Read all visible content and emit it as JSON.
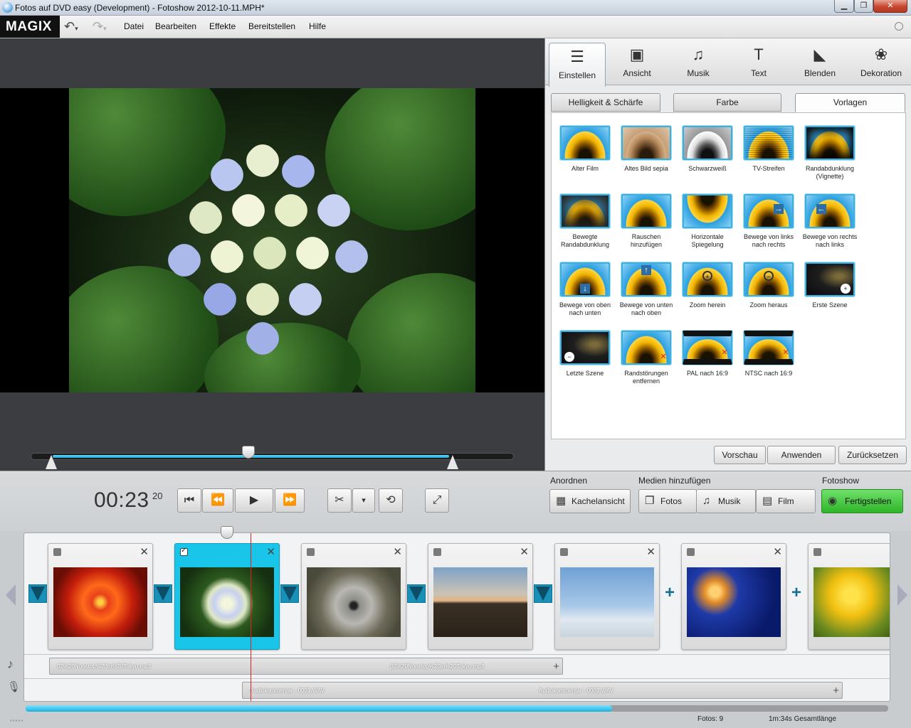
{
  "window": {
    "title": "Fotos auf DVD easy (Development) - Fotoshow 2012-10-11.MPH*",
    "minimize": "▁",
    "maximize": "❐",
    "close": "✕"
  },
  "menubar": {
    "logo": "MAGIX",
    "undo_icon": "undo-icon",
    "redo_icon": "redo-icon",
    "items": [
      "Datei",
      "Bearbeiten",
      "Effekte",
      "Bereitstellen",
      "Hilfe"
    ]
  },
  "panel": {
    "tabs": [
      {
        "label": "Einstellen",
        "icon": "sliders-icon",
        "glyph": "☰"
      },
      {
        "label": "Ansicht",
        "icon": "photo-stack-icon",
        "glyph": "▣"
      },
      {
        "label": "Musik",
        "icon": "music-note-icon",
        "glyph": "♫"
      },
      {
        "label": "Text",
        "icon": "text-t-icon",
        "glyph": "T"
      },
      {
        "label": "Blenden",
        "icon": "transition-icon",
        "glyph": "◣"
      },
      {
        "label": "Dekoration",
        "icon": "flower-icon",
        "glyph": "❀"
      }
    ],
    "subtabs": [
      "Helligkeit & Schärfe",
      "Farbe",
      "Vorlagen"
    ],
    "templates": [
      "Alter Film",
      "Altes Bild sepia",
      "Schwarzweiß",
      "TV-Streifen",
      "Randabdunklung (Vignette)",
      "Bewegte Randabdunklung",
      "Rauschen hinzufügen",
      "Horizontale Spiegelung",
      "Bewege von links nach rechts",
      "Bewege von rechts nach links",
      "Bewege von oben nach unten",
      "Bewege von unten nach oben",
      "Zoom herein",
      "Zoom heraus",
      "Erste Szene",
      "Letzte Szene",
      "Randstörungen entfernen",
      "PAL nach 16:9",
      "NTSC nach 16:9"
    ],
    "buttons": {
      "preview": "Vorschau",
      "apply": "Anwenden",
      "reset": "Zurücksetzen"
    }
  },
  "preview": {
    "position_percent": 45
  },
  "transport": {
    "timecode": "00:23",
    "frames": "20",
    "icons": [
      "skip-to-start-icon",
      "rewind-icon",
      "play-icon",
      "fast-forward-icon",
      "scissors-icon",
      "dropdown-icon",
      "photo-rotate-icon",
      "fullscreen-icon"
    ]
  },
  "groups": {
    "arrange": {
      "label": "Anordnen",
      "buttons": [
        {
          "label": "Kachelansicht",
          "icon": "grid-icon"
        }
      ]
    },
    "add_media": {
      "label": "Medien hinzufügen",
      "buttons": [
        {
          "label": "Fotos",
          "icon": "photos-icon"
        },
        {
          "label": "Musik",
          "icon": "music-note-icon"
        },
        {
          "label": "Film",
          "icon": "film-icon"
        }
      ]
    },
    "show": {
      "label": "Fotoshow",
      "buttons": [
        {
          "label": "Fertigstellen",
          "icon": "finish-disc-icon"
        }
      ]
    }
  },
  "storyboard": {
    "clips": [
      {
        "name": "red-flower",
        "selected": false
      },
      {
        "name": "hydrangea",
        "selected": true
      },
      {
        "name": "koala",
        "selected": false
      },
      {
        "name": "lighthouse",
        "selected": false
      },
      {
        "name": "penguins",
        "selected": false
      },
      {
        "name": "jellyfish",
        "selected": false
      },
      {
        "name": "tulips",
        "selected": false
      }
    ],
    "music_track": {
      "label_left": "02%20Nonstop%20to%20Tokyo.mp3",
      "label_right": "02%20Nonstop%20to%20Tokyo.mp3"
    },
    "audio_track": {
      "label_left": "Audiokommentar - 0001.WAV",
      "label_right": "Audiokommentar - 0001.WAV"
    },
    "progress_percent": 68
  },
  "status": {
    "photos": "Fotos: 9",
    "length": "1m:34s Gesamtlänge"
  },
  "colors": {
    "accent": "#19c6ea",
    "finish": "#2fb52a",
    "playhead": "#e02020"
  }
}
